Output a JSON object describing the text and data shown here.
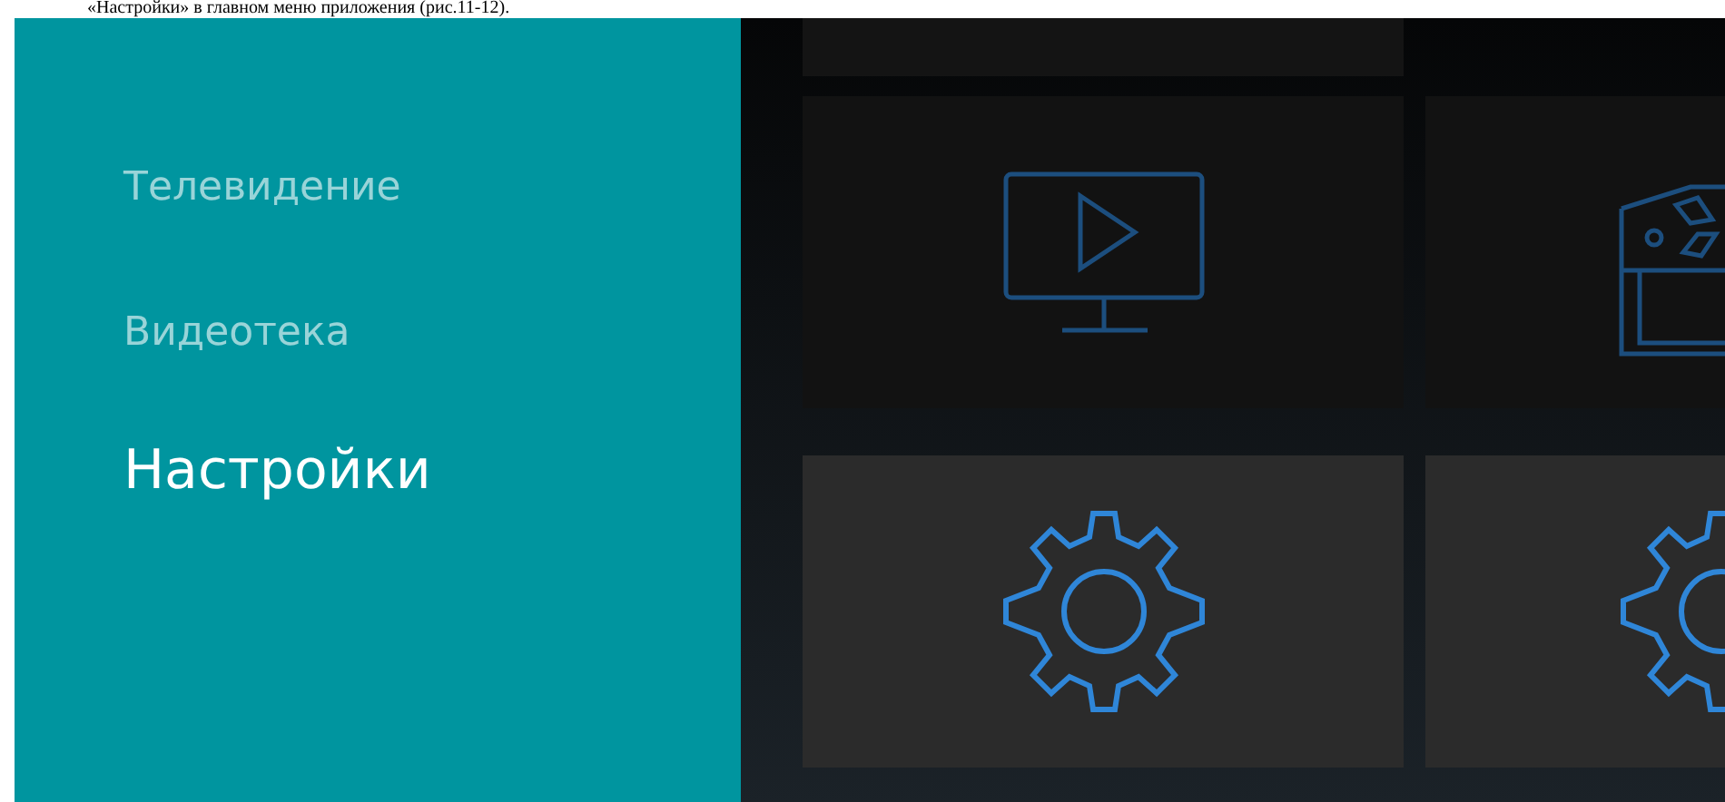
{
  "caption": "«Настройки» в главном меню приложения (рис.11-12).",
  "menu": [
    {
      "label": "Телевидение",
      "selected": false
    },
    {
      "label": "Видеотека",
      "selected": false
    },
    {
      "label": "Настройки",
      "selected": true
    }
  ],
  "tile_rows": [
    [
      {
        "kind": "blank",
        "selected": false
      }
    ],
    [
      {
        "kind": "tv",
        "selected": false
      },
      {
        "kind": "clapper",
        "selected": false
      }
    ],
    [
      {
        "kind": "gear",
        "selected": true
      },
      {
        "kind": "gear",
        "selected": true
      }
    ]
  ]
}
